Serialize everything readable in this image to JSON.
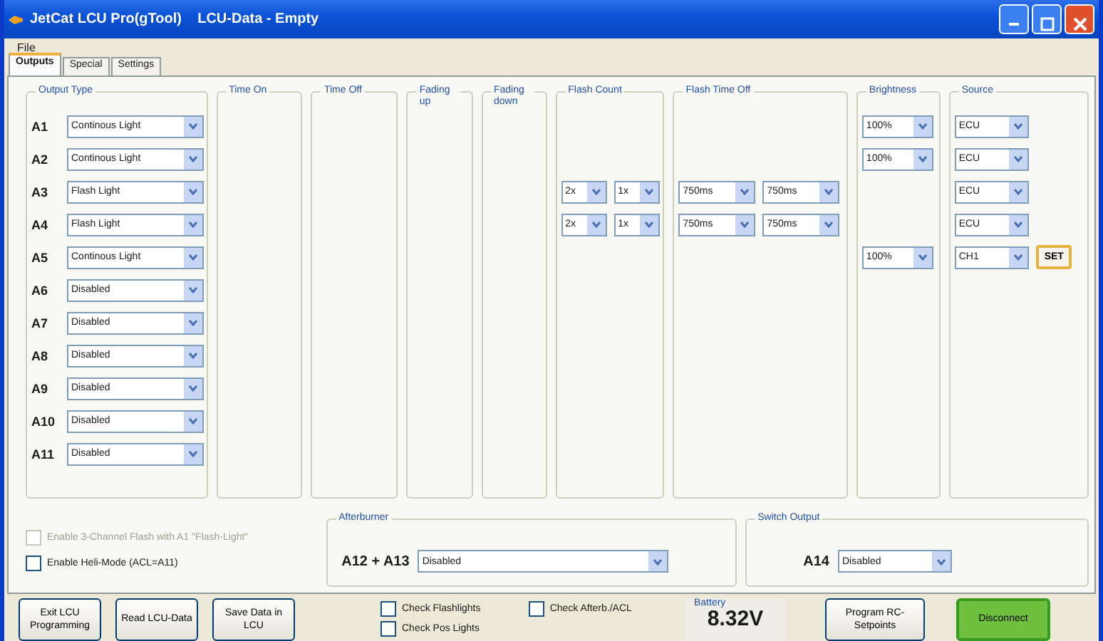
{
  "window": {
    "title": "JetCat LCU Pro(gTool)    LCU-Data - Empty"
  },
  "menu": [
    "File"
  ],
  "tabs": [
    {
      "label": "Outputs",
      "selected": true
    },
    {
      "label": "Special",
      "selected": false
    },
    {
      "label": "Settings",
      "selected": false
    }
  ],
  "groups": [
    {
      "title": "Output Type"
    },
    {
      "title": "Time On"
    },
    {
      "title": "Time Off"
    },
    {
      "title": "Fading up"
    },
    {
      "title": "Fading down"
    },
    {
      "title": "Flash Count"
    },
    {
      "title": "Flash Time Off"
    },
    {
      "title": "Brightness"
    },
    {
      "title": "Source"
    }
  ],
  "outputs": [
    {
      "name": "A1",
      "output_type": "Continous Light",
      "brightness": "100%",
      "source": "ECU"
    },
    {
      "name": "A2",
      "output_type": "Continous Light",
      "brightness": "100%",
      "source": "ECU"
    },
    {
      "name": "A3",
      "output_type": "Flash Light",
      "flash_count": [
        "2x",
        "1x"
      ],
      "flash_time_off": [
        "750ms",
        "750ms"
      ],
      "source": "ECU"
    },
    {
      "name": "A4",
      "output_type": "Flash Light",
      "flash_count": [
        "2x",
        "1x"
      ],
      "flash_time_off": [
        "750ms",
        "750ms"
      ],
      "source": "ECU"
    },
    {
      "name": "A5",
      "output_type": "Continous Light",
      "brightness": "100%",
      "source": "CH1",
      "set_button": "SET"
    },
    {
      "name": "A6",
      "output_type": "Disabled"
    },
    {
      "name": "A7",
      "output_type": "Disabled"
    },
    {
      "name": "A8",
      "output_type": "Disabled"
    },
    {
      "name": "A9",
      "output_type": "Disabled"
    },
    {
      "name": "A10",
      "output_type": "Disabled"
    },
    {
      "name": "A11",
      "output_type": "Disabled"
    }
  ],
  "options": [
    {
      "label": "Enable 3-Channel Flash with A1 \"Flash-Light\"",
      "checked": false,
      "disabled": true
    },
    {
      "label": "Enable Heli-Mode (ACL=A11)",
      "checked": false,
      "disabled": false
    }
  ],
  "afterburner": {
    "title": "Afterburner",
    "label": "A12 + A13",
    "value": "Disabled"
  },
  "switch_output": {
    "title": "Switch Output",
    "label": "A14",
    "value": "Disabled"
  },
  "buttons": [
    "Exit LCU Programming",
    "Read LCU-Data",
    "Save Data in LCU"
  ],
  "checks": [
    {
      "label": "Check Flashlights",
      "checked": false
    },
    {
      "label": "Check Afterb./ACL",
      "checked": false
    },
    {
      "label": "Check Pos Lights",
      "checked": false
    }
  ],
  "battery": {
    "label": "Battery",
    "value": "8.32V"
  },
  "program_button": "Program RC-Setpoints",
  "disconnect_button": {
    "label": "Disconnect",
    "connected": true
  }
}
